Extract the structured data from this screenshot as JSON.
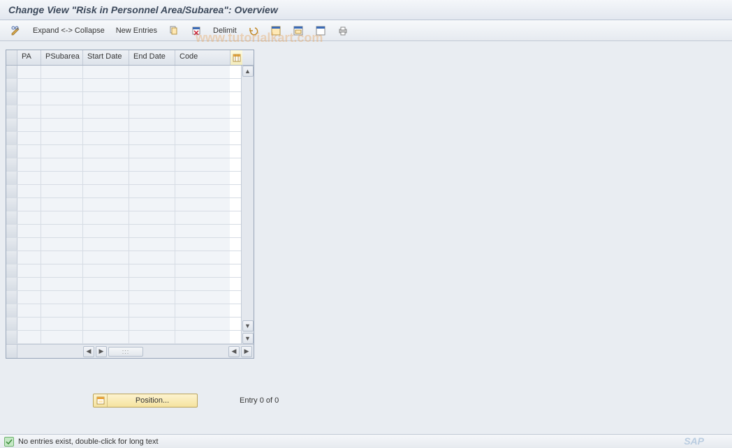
{
  "title": "Change View \"Risk in Personnel Area/Subarea\": Overview",
  "watermark": "www.tutorialkart.com",
  "toolbar": {
    "expand_collapse": "Expand <-> Collapse",
    "new_entries": "New Entries",
    "delimit": "Delimit"
  },
  "grid": {
    "columns": {
      "pa": "PA",
      "psubarea": "PSubarea",
      "start_date": "Start Date",
      "end_date": "End Date",
      "code": "Code"
    },
    "row_count": 21
  },
  "position": {
    "label": "Position...",
    "entry_text": "Entry 0 of 0"
  },
  "status": {
    "message": "No entries exist, double-click for long text"
  }
}
